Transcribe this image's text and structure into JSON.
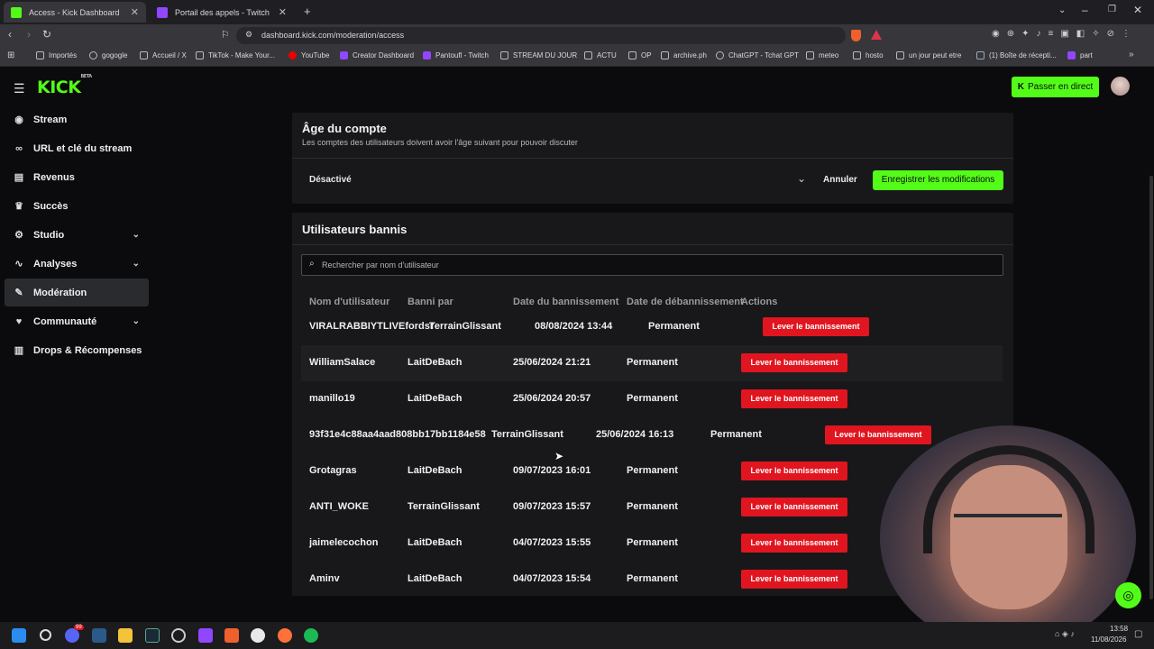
{
  "browser": {
    "tabs": [
      {
        "label": "Access - Kick Dashboard",
        "active": true,
        "color": "#53fc18"
      },
      {
        "label": "Portail des appels - Twitch",
        "active": false,
        "color": "#9146ff"
      }
    ],
    "new_tab": "+",
    "url": "dashboard.kick.com/moderation/access",
    "bookmarks": [
      "Importés",
      "gogogle",
      "Accueil / X",
      "TikTok - Make Your...",
      "YouTube",
      "Creator Dashboard",
      "Pantoufl - Twitch",
      "STREAM DU JOUR",
      "ACTU",
      "OP",
      "archive.ph",
      "ChatGPT - Tchat GPT",
      "meteo",
      "hosto",
      "un jour peut etre",
      "(1) Boîte de récepti...",
      "part"
    ]
  },
  "app": {
    "logo": "KICK",
    "logo_beta": "BETA",
    "go_live_label": "Passer en direct",
    "sidebar": {
      "items": [
        {
          "label": "Stream",
          "icon": "signal-icon",
          "glyph": "((·))"
        },
        {
          "label": "URL et clé du stream",
          "icon": "link-icon",
          "glyph": "⛓"
        },
        {
          "label": "Revenus",
          "icon": "chart-icon",
          "glyph": "▮"
        },
        {
          "label": "Succès",
          "icon": "trophy-icon",
          "glyph": "🏆"
        },
        {
          "label": "Studio",
          "icon": "sliders-icon",
          "glyph": "⚙",
          "chevron": true
        },
        {
          "label": "Analyses",
          "icon": "pulse-icon",
          "glyph": "∿",
          "chevron": true
        },
        {
          "label": "Modération",
          "icon": "wrench-icon",
          "glyph": "🔧",
          "active": true
        },
        {
          "label": "Communauté",
          "icon": "heart-icon",
          "glyph": "♥",
          "chevron": true
        },
        {
          "label": "Drops & Récompenses",
          "icon": "gift-icon",
          "glyph": "⊞"
        }
      ]
    },
    "account_age": {
      "title": "Âge du compte",
      "subtitle": "Les comptes des utilisateurs doivent avoir l'âge suivant pour pouvoir discuter",
      "select_value": "Désactivé",
      "cancel_label": "Annuler",
      "save_label": "Enregistrer les modifications"
    },
    "banned": {
      "title": "Utilisateurs bannis",
      "search_placeholder": "Rechercher par nom d'utilisateur",
      "columns": [
        "Nom d'utilisateur",
        "Banni par",
        "Date du bannissement",
        "Date de débannissement",
        "Actions"
      ],
      "action_label": "Lever le bannissement",
      "rows": [
        {
          "user": "VIRALRABBIYTLIVEfordsr",
          "by": "TerrainGlissant",
          "date": "08/08/2024 13:44",
          "unban": "Permanent"
        },
        {
          "user": "WilliamSalace",
          "by": "LaitDeBach",
          "date": "25/06/2024 21:21",
          "unban": "Permanent"
        },
        {
          "user": "manillo19",
          "by": "LaitDeBach",
          "date": "25/06/2024 20:57",
          "unban": "Permanent"
        },
        {
          "user": "93f31e4c88aa4aad808bb17bb1184e58",
          "by": "TerrainGlissant",
          "date": "25/06/2024 16:13",
          "unban": "Permanent"
        },
        {
          "user": "Grotagras",
          "by": "LaitDeBach",
          "date": "09/07/2023 16:01",
          "unban": "Permanent"
        },
        {
          "user": "ANTI_WOKE",
          "by": "TerrainGlissant",
          "date": "09/07/2023 15:57",
          "unban": "Permanent"
        },
        {
          "user": "jaimelecochon",
          "by": "LaitDeBach",
          "date": "04/07/2023 15:55",
          "unban": "Permanent"
        },
        {
          "user": "Aminv",
          "by": "LaitDeBach",
          "date": "04/07/2023 15:54",
          "unban": "Permanent"
        }
      ]
    }
  },
  "taskbar": {
    "time": "13:58",
    "date": "11/08/2026",
    "notification_badge": "99"
  },
  "colors": {
    "accent": "#53fc18",
    "danger": "#e0151f",
    "panel": "#18181b"
  }
}
